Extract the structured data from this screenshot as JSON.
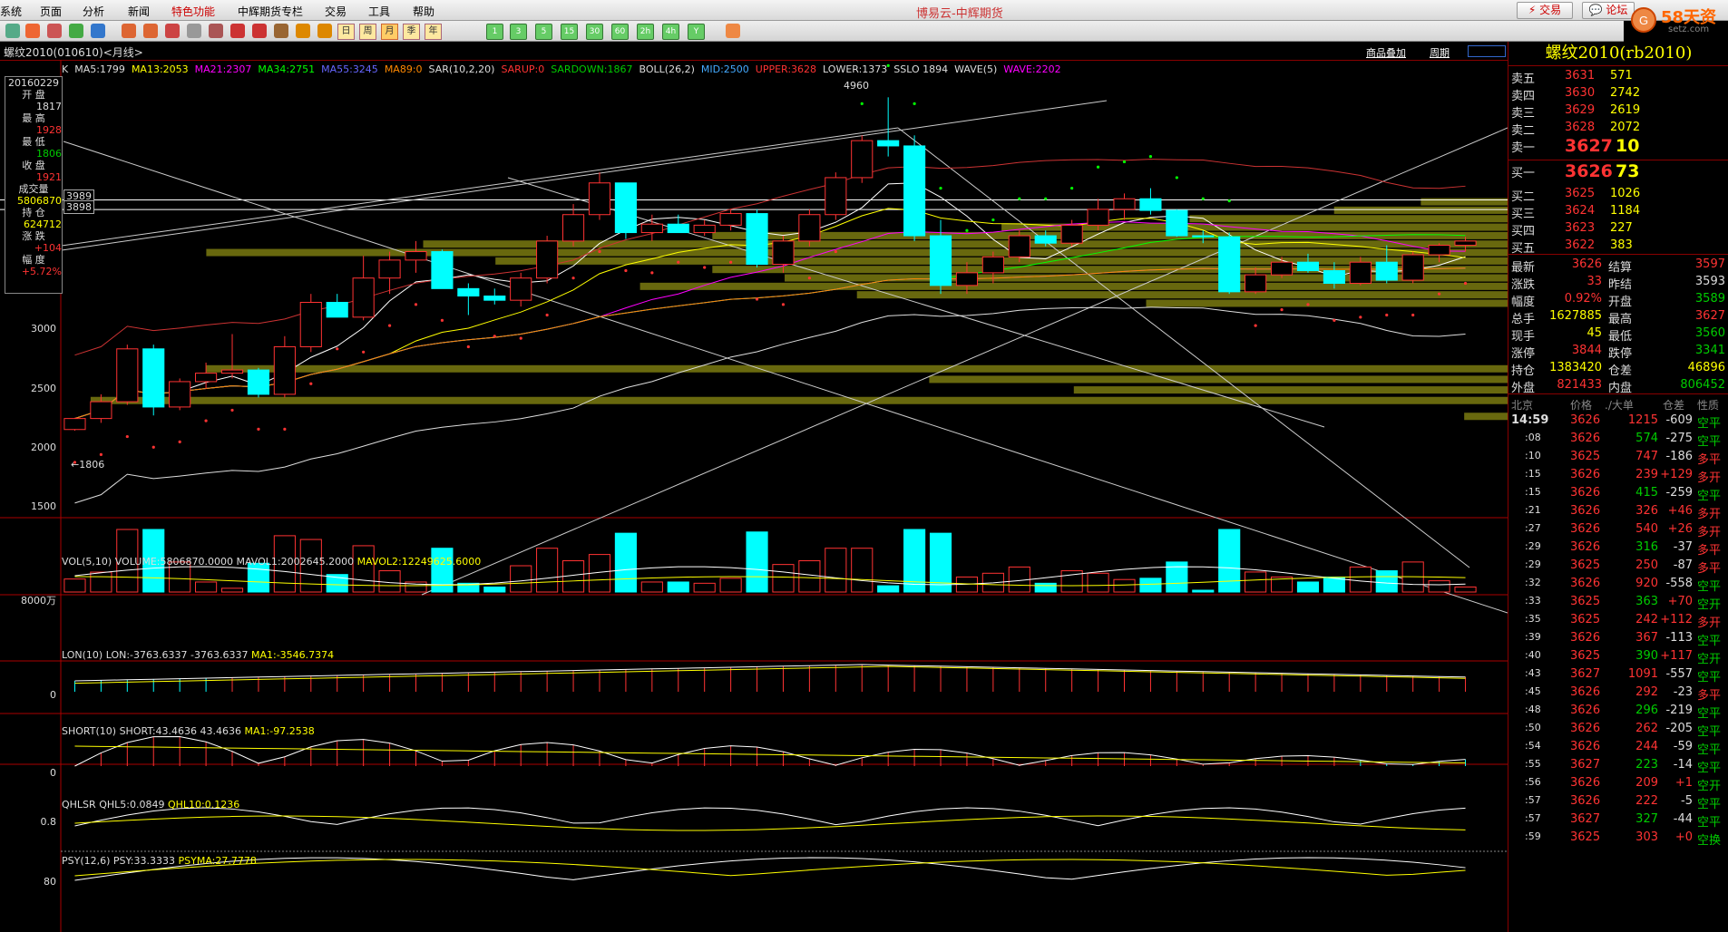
{
  "app_title": "博易云-中辉期货",
  "menu": [
    "系统",
    "页面",
    "分析",
    "新闻",
    "特色功能",
    "中辉期货专栏",
    "交易",
    "工具",
    "帮助"
  ],
  "top_buttons": {
    "trade": "交易",
    "forum": "论坛"
  },
  "logo_text": "58天资",
  "logo_sub": "setz.com",
  "toolbar_periods": [
    "日",
    "周",
    "月",
    "季",
    "年"
  ],
  "toolbar_numbers": [
    "1",
    "3",
    "5",
    "15",
    "30",
    "60",
    "2h",
    "4h",
    "Y"
  ],
  "chart_header": {
    "title": "螺纹2010(010610)<月线>",
    "overlay": "商品叠加",
    "period": "周期"
  },
  "main_indicator": {
    "k": "K",
    "ma5": "MA5:1799",
    "ma13": "MA13:2053",
    "ma21": "MA21:2307",
    "ma34": "MA34:2751",
    "ma55": "MA55:3245",
    "ma89": "MA89:0",
    "sar": "SAR(10,2,20)",
    "sarup": "SARUP:0",
    "sardown": "SARDOWN:1867",
    "boll": "BOLL(26,2)",
    "mid": "MID:2500",
    "upper": "UPPER:3628",
    "lower": "LOWER:1373",
    "sslo": "SSLO 1894",
    "wave": "WAVE(5)",
    "wave_val": "WAVE:2202"
  },
  "price_axis": [
    "3000",
    "2500",
    "2000",
    "1500"
  ],
  "hl_labels": {
    "high": "4960",
    "low": "←1806",
    "l1": "3989",
    "l2": "3898"
  },
  "info_box": {
    "date": "20160229",
    "open_l": "开  盘",
    "open": "1817",
    "high_l": "最  高",
    "high": "1928",
    "low_l": "最  低",
    "low": "1806",
    "close_l": "收  盘",
    "close": "1921",
    "vol_l": "成交量",
    "vol": "5806870",
    "oi_l": "持  仓",
    "oi": "624712",
    "chg_l": "涨  跌",
    "chg": "+104",
    "pct_l": "幅  度",
    "pct": "+5.72%"
  },
  "vol_indicator": {
    "name": "VOL(5,10)",
    "volume": "VOLUME:5806870.0000",
    "mavol1": "MAVOL1:2002645.2000",
    "mavol2": "MAVOL2:12249625.6000",
    "axis": "8000万"
  },
  "lon_indicator": {
    "name": "LON(10)",
    "lon": "LON:-3763.6337",
    "val": "-3763.6337",
    "ma1": "MA1:-3546.7374",
    "axis": "0"
  },
  "short_indicator": {
    "name": "SHORT(10)",
    "short": "SHORT:43.4636",
    "val": "43.4636",
    "ma1": "MA1:-97.2538",
    "axis": "0"
  },
  "qhlsr_indicator": {
    "name": "QHLSR",
    "qhl5": "QHL5:0.0849",
    "qhl10": "QHL10:0.1236",
    "axis": "0.8"
  },
  "psy_indicator": {
    "name": "PSY(12,6)",
    "psy": "PSY:33.3333",
    "psyma": "PSYMA:27.7778",
    "axis": "80"
  },
  "right_panel": {
    "title": "螺纹2010(rb2010)",
    "asks": [
      {
        "label": "卖五",
        "price": "3631",
        "vol": "571"
      },
      {
        "label": "卖四",
        "price": "3630",
        "vol": "2742"
      },
      {
        "label": "卖三",
        "price": "3629",
        "vol": "2619"
      },
      {
        "label": "卖二",
        "price": "3628",
        "vol": "2072"
      },
      {
        "label": "卖一",
        "price": "3627",
        "vol": "10"
      }
    ],
    "bids": [
      {
        "label": "买一",
        "price": "3626",
        "vol": "73"
      },
      {
        "label": "买二",
        "price": "3625",
        "vol": "1026"
      },
      {
        "label": "买三",
        "price": "3624",
        "vol": "1184"
      },
      {
        "label": "买四",
        "price": "3623",
        "vol": "227"
      },
      {
        "label": "买五",
        "price": "3622",
        "vol": "383"
      }
    ],
    "stats": [
      {
        "l1": "最新",
        "v1": "3626",
        "l2": "结算",
        "v2": "3597"
      },
      {
        "l1": "涨跌",
        "v1": "33",
        "l2": "昨结",
        "v2": "3593"
      },
      {
        "l1": "幅度",
        "v1": "0.92%",
        "l2": "开盘",
        "v2": "3589"
      },
      {
        "l1": "总手",
        "v1": "1627885",
        "l2": "最高",
        "v2": "3627"
      },
      {
        "l1": "现手",
        "v1": "45",
        "l2": "最低",
        "v2": "3560"
      },
      {
        "l1": "涨停",
        "v1": "3844",
        "l2": "跌停",
        "v2": "3341"
      },
      {
        "l1": "持仓",
        "v1": "1383420",
        "l2": "仓差",
        "v2": "46896"
      },
      {
        "l1": "外盘",
        "v1": "821433",
        "l2": "内盘",
        "v2": "806452"
      }
    ],
    "tick_header": {
      "loc": "北京",
      "price": "价格",
      "vol": "./大单",
      "oi": "仓差",
      "nature": "性质"
    },
    "ticks": [
      {
        "t": "14:59",
        "p": "3626",
        "v": "1215",
        "o": "-609",
        "n": "空平"
      },
      {
        "t": ":08",
        "p": "3626",
        "v": "574",
        "o": "-275",
        "n": "空平"
      },
      {
        "t": ":10",
        "p": "3625",
        "v": "747",
        "o": "-186",
        "n": "多平"
      },
      {
        "t": ":15",
        "p": "3626",
        "v": "239",
        "o": "+129",
        "n": "多开"
      },
      {
        "t": ":15",
        "p": "3626",
        "v": "415",
        "o": "-259",
        "n": "空平"
      },
      {
        "t": ":21",
        "p": "3626",
        "v": "326",
        "o": "+46",
        "n": "多开"
      },
      {
        "t": ":27",
        "p": "3626",
        "v": "540",
        "o": "+26",
        "n": "多开"
      },
      {
        "t": ":29",
        "p": "3626",
        "v": "316",
        "o": "-37",
        "n": "多平"
      },
      {
        "t": ":29",
        "p": "3625",
        "v": "250",
        "o": "-87",
        "n": "多平"
      },
      {
        "t": ":32",
        "p": "3626",
        "v": "920",
        "o": "-558",
        "n": "空平"
      },
      {
        "t": ":33",
        "p": "3625",
        "v": "363",
        "o": "+70",
        "n": "空开"
      },
      {
        "t": ":35",
        "p": "3625",
        "v": "242",
        "o": "+112",
        "n": "多开"
      },
      {
        "t": ":39",
        "p": "3626",
        "v": "367",
        "o": "-113",
        "n": "空平"
      },
      {
        "t": ":40",
        "p": "3625",
        "v": "390",
        "o": "+117",
        "n": "空开"
      },
      {
        "t": ":43",
        "p": "3627",
        "v": "1091",
        "o": "-557",
        "n": "空平"
      },
      {
        "t": ":45",
        "p": "3626",
        "v": "292",
        "o": "-23",
        "n": "多平"
      },
      {
        "t": ":48",
        "p": "3626",
        "v": "296",
        "o": "-219",
        "n": "空平"
      },
      {
        "t": ":50",
        "p": "3626",
        "v": "262",
        "o": "-205",
        "n": "空平"
      },
      {
        "t": ":54",
        "p": "3626",
        "v": "244",
        "o": "-59",
        "n": "空平"
      },
      {
        "t": ":55",
        "p": "3627",
        "v": "223",
        "o": "-14",
        "n": "空平"
      },
      {
        "t": ":56",
        "p": "3626",
        "v": "209",
        "o": "+1",
        "n": "空开"
      },
      {
        "t": ":57",
        "p": "3626",
        "v": "222",
        "o": "-5",
        "n": "空平"
      },
      {
        "t": ":57",
        "p": "3627",
        "v": "327",
        "o": "-44",
        "n": "空平"
      },
      {
        "t": ":59",
        "p": "3625",
        "v": "303",
        "o": "+0",
        "n": "空换"
      }
    ]
  },
  "candles": [
    {
      "o": 1817,
      "h": 1928,
      "l": 1806,
      "c": 1921
    },
    {
      "o": 1921,
      "h": 2150,
      "l": 1880,
      "c": 2080
    },
    {
      "o": 2080,
      "h": 2620,
      "l": 2050,
      "c": 2580
    },
    {
      "o": 2580,
      "h": 2620,
      "l": 1950,
      "c": 2030
    },
    {
      "o": 2030,
      "h": 2300,
      "l": 2000,
      "c": 2270
    },
    {
      "o": 2270,
      "h": 2450,
      "l": 2200,
      "c": 2350
    },
    {
      "o": 2350,
      "h": 2720,
      "l": 2300,
      "c": 2380
    },
    {
      "o": 2380,
      "h": 2400,
      "l": 2120,
      "c": 2150
    },
    {
      "o": 2150,
      "h": 2700,
      "l": 2120,
      "c": 2600
    },
    {
      "o": 2600,
      "h": 3100,
      "l": 2550,
      "c": 3020
    },
    {
      "o": 3020,
      "h": 3100,
      "l": 2880,
      "c": 2880
    },
    {
      "o": 2880,
      "h": 3460,
      "l": 2850,
      "c": 3250
    },
    {
      "o": 3250,
      "h": 3500,
      "l": 3100,
      "c": 3420
    },
    {
      "o": 3420,
      "h": 3600,
      "l": 3300,
      "c": 3500
    },
    {
      "o": 3500,
      "h": 3520,
      "l": 3150,
      "c": 3150
    },
    {
      "o": 3150,
      "h": 3200,
      "l": 2900,
      "c": 3080
    },
    {
      "o": 3080,
      "h": 3150,
      "l": 3000,
      "c": 3040
    },
    {
      "o": 3040,
      "h": 3300,
      "l": 2980,
      "c": 3250
    },
    {
      "o": 3250,
      "h": 3650,
      "l": 3200,
      "c": 3600
    },
    {
      "o": 3600,
      "h": 3950,
      "l": 3550,
      "c": 3850
    },
    {
      "o": 3850,
      "h": 4250,
      "l": 3800,
      "c": 4150
    },
    {
      "o": 4150,
      "h": 4150,
      "l": 3620,
      "c": 3680
    },
    {
      "o": 3680,
      "h": 3850,
      "l": 3600,
      "c": 3760
    },
    {
      "o": 3760,
      "h": 3850,
      "l": 3700,
      "c": 3680
    },
    {
      "o": 3680,
      "h": 3800,
      "l": 3650,
      "c": 3750
    },
    {
      "o": 3750,
      "h": 3900,
      "l": 3700,
      "c": 3860
    },
    {
      "o": 3860,
      "h": 3900,
      "l": 3350,
      "c": 3380
    },
    {
      "o": 3380,
      "h": 3650,
      "l": 3300,
      "c": 3600
    },
    {
      "o": 3600,
      "h": 3900,
      "l": 3550,
      "c": 3850
    },
    {
      "o": 3850,
      "h": 4250,
      "l": 3800,
      "c": 4200
    },
    {
      "o": 4200,
      "h": 4600,
      "l": 4150,
      "c": 4550
    },
    {
      "o": 4550,
      "h": 4960,
      "l": 4400,
      "c": 4500
    },
    {
      "o": 4500,
      "h": 4600,
      "l": 3600,
      "c": 3650
    },
    {
      "o": 3650,
      "h": 3800,
      "l": 3100,
      "c": 3180
    },
    {
      "o": 3180,
      "h": 3400,
      "l": 3100,
      "c": 3300
    },
    {
      "o": 3300,
      "h": 3500,
      "l": 3200,
      "c": 3450
    },
    {
      "o": 3450,
      "h": 3700,
      "l": 3400,
      "c": 3650
    },
    {
      "o": 3650,
      "h": 3700,
      "l": 3550,
      "c": 3580
    },
    {
      "o": 3580,
      "h": 3800,
      "l": 3550,
      "c": 3750
    },
    {
      "o": 3750,
      "h": 4000,
      "l": 3700,
      "c": 3900
    },
    {
      "o": 3900,
      "h": 4050,
      "l": 3800,
      "c": 4000
    },
    {
      "o": 4000,
      "h": 4100,
      "l": 3850,
      "c": 3890
    },
    {
      "o": 3890,
      "h": 3900,
      "l": 3640,
      "c": 3650
    },
    {
      "o": 3650,
      "h": 3700,
      "l": 3580,
      "c": 3640
    },
    {
      "o": 3640,
      "h": 3680,
      "l": 3100,
      "c": 3120
    },
    {
      "o": 3120,
      "h": 3350,
      "l": 3100,
      "c": 3280
    },
    {
      "o": 3280,
      "h": 3450,
      "l": 3250,
      "c": 3400
    },
    {
      "o": 3400,
      "h": 3480,
      "l": 3300,
      "c": 3320
    },
    {
      "o": 3320,
      "h": 3400,
      "l": 3150,
      "c": 3200
    },
    {
      "o": 3200,
      "h": 3450,
      "l": 3180,
      "c": 3400
    },
    {
      "o": 3400,
      "h": 3560,
      "l": 3200,
      "c": 3230
    },
    {
      "o": 3230,
      "h": 3500,
      "l": 3200,
      "c": 3470
    },
    {
      "o": 3470,
      "h": 3580,
      "l": 3400,
      "c": 3560
    },
    {
      "o": 3560,
      "h": 3640,
      "l": 3500,
      "c": 3600
    }
  ]
}
